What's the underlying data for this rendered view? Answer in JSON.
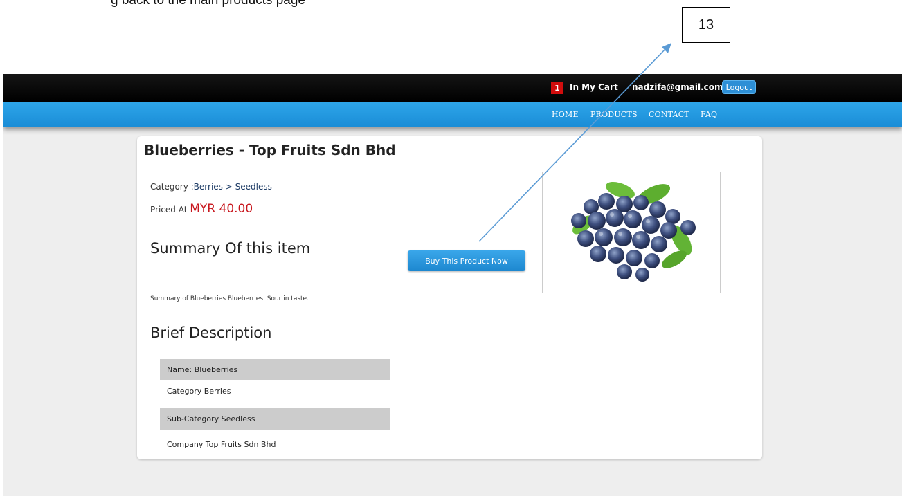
{
  "caption": {
    "text": "g back to the main products page"
  },
  "callout": {
    "number": "13"
  },
  "header": {
    "cart_count": "1",
    "cart_label": "In My Cart",
    "user_email": "nadzifa@gmail.com",
    "logout_label": "Logout"
  },
  "nav": {
    "items": [
      {
        "label": "HOME"
      },
      {
        "label": "PRODUCTS"
      },
      {
        "label": "CONTACT"
      },
      {
        "label": "FAQ"
      }
    ]
  },
  "product": {
    "title": "Blueberries - Top Fruits Sdn Bhd",
    "category_prefix": "Category :",
    "category": "Berries",
    "category_sep": " > ",
    "subcategory": "Seedless",
    "price_prefix": "Priced At ",
    "price": "MYR 40.00",
    "summary_heading": "Summary Of this item",
    "summary_text": "Summary of Blueberries Blueberries. Sour in taste.",
    "buy_label": "Buy This Product Now",
    "brief_heading": "Brief Description",
    "brief_rows": [
      {
        "text": "Name:  Blueberries"
      },
      {
        "text": "Category  Berries"
      },
      {
        "text": "Sub-Category  Seedless"
      },
      {
        "text": "Company  Top Fruits Sdn Bhd"
      }
    ]
  },
  "colors": {
    "topbar": "#000000",
    "navbar": "#1e96de",
    "price": "#c8161d",
    "badge": "#d10d0d",
    "annotation_arrow": "#5b9bd5"
  }
}
